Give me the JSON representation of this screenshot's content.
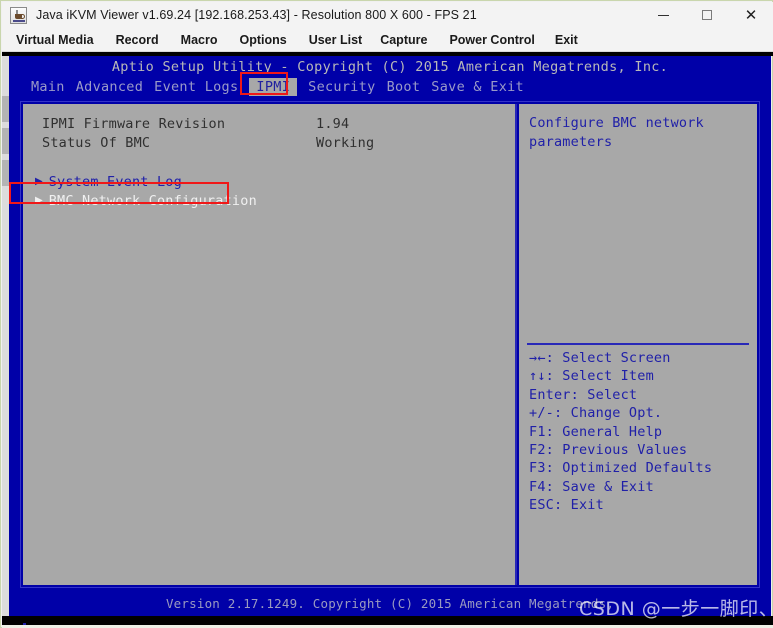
{
  "window": {
    "title": "Java iKVM Viewer v1.69.24 [192.168.253.43]  - Resolution 800 X 600 - FPS 21",
    "icon": "java-coffee-cup-icon",
    "controls": {
      "minimize": "minimize-icon",
      "maximize": "maximize-icon",
      "close": "close-icon"
    }
  },
  "menubar": {
    "items": [
      {
        "label": "Virtual Media"
      },
      {
        "label": "Record"
      },
      {
        "label": "Macro"
      },
      {
        "label": "Options"
      },
      {
        "label": "User List"
      },
      {
        "label": "Capture"
      },
      {
        "label": "Power Control"
      },
      {
        "label": "Exit"
      }
    ]
  },
  "bios": {
    "header": "Aptio Setup Utility - Copyright (C) 2015 American Megatrends, Inc.",
    "tabs": [
      {
        "label": "Main",
        "selected": false
      },
      {
        "label": "Advanced",
        "selected": false
      },
      {
        "label": "Event Logs",
        "selected": false
      },
      {
        "label": "IPMI",
        "selected": true
      },
      {
        "label": "Security",
        "selected": false
      },
      {
        "label": "Boot",
        "selected": false
      },
      {
        "label": "Save & Exit",
        "selected": false
      }
    ],
    "info_rows": [
      {
        "label": "IPMI Firmware Revision",
        "value": "1.94"
      },
      {
        "label": "Status Of BMC",
        "value": "Working"
      }
    ],
    "nav_items": [
      {
        "label": "System Event Log",
        "arrow": "triangle-right-icon",
        "selected": false
      },
      {
        "label": "BMC Network Configuration",
        "arrow": "triangle-right-icon",
        "selected": true
      }
    ],
    "help_text": "Configure BMC network parameters",
    "legend": [
      {
        "key": "→←",
        "action": ": Select Screen"
      },
      {
        "key": "↑↓",
        "action": ": Select Item"
      },
      {
        "key": "Enter",
        "action": ": Select"
      },
      {
        "key": "+/-",
        "action": ": Change Opt."
      },
      {
        "key": "F1",
        "action": ": General Help"
      },
      {
        "key": "F2",
        "action": ": Previous Values"
      },
      {
        "key": "F3",
        "action": ": Optimized Defaults"
      },
      {
        "key": "F4",
        "action": ": Save & Exit"
      },
      {
        "key": "ESC",
        "action": ": Exit"
      }
    ],
    "legend_text": "→←: Select Screen\n↑↓: Select Item\nEnter: Select\n+/-: Change Opt.\nF1: General Help\nF2: Previous Values\nF3: Optimized Defaults\nF4: Save & Exit\nESC: Exit",
    "version": "Version 2.17.1249. Copyright (C) 2015 American Megatrends,"
  },
  "watermark": "CSDN @一步一脚印、",
  "annotations": [
    {
      "name": "ipmi-tab-highlight"
    },
    {
      "name": "bmc-network-configuration-highlight"
    }
  ],
  "colors": {
    "bios_background": "#0000a8",
    "panel_background": "#a8a8a8",
    "panel_border": "#3434c8",
    "bios_text": "#b8b8b8",
    "help_text": "#2020a8",
    "selected_text": "#f0f0f0",
    "annotation_red": "#f01818",
    "titlebar_background": "#f3f3f3"
  }
}
